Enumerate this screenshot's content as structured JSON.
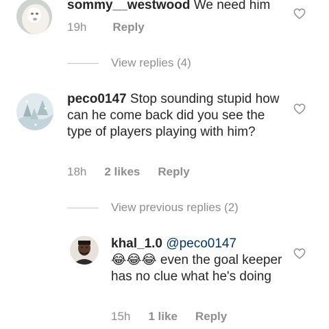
{
  "comments": [
    {
      "username": "sommy__westwood",
      "text": " We need him",
      "time": "19h",
      "likes": "",
      "reply_label": "Reply",
      "avatar": "white-lion-avatar"
    },
    {
      "username": "peco0147",
      "text": " Stop sounding stupid how can he come back did you see the type of players playing with him?",
      "time": "18h",
      "likes": "2 likes",
      "reply_label": "Reply",
      "avatar": "snowy-tree-avatar"
    },
    {
      "username": "khal_1.0",
      "mention": "@peco0147",
      "emoji": "😂😂😂",
      "text": " even the goal keeper has no clue what he's doing",
      "time": "15h",
      "likes": "1 like",
      "reply_label": "Reply",
      "avatar": "man-portrait-avatar"
    }
  ],
  "view_replies": "View replies (4)",
  "view_previous_replies": "View previous replies (2)",
  "icons": {
    "like": "heart-outline-icon"
  },
  "colors": {
    "text": "#262626",
    "secondary": "#8e8e8e",
    "mention": "#003569"
  }
}
